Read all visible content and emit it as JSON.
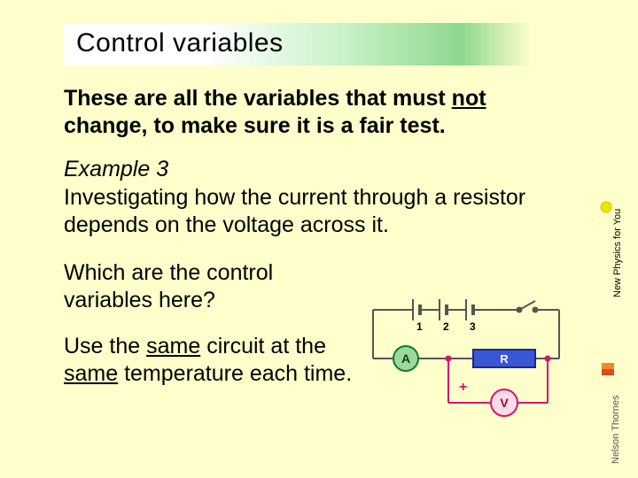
{
  "title": "Control variables",
  "intro": {
    "line1a": "These are all the variables that must ",
    "not": "not",
    "line2": "change, to make sure it is a fair test."
  },
  "example_label": "Example 3",
  "example_text": "Investigating how the current through a resistor depends on the voltage across it.",
  "question": "Which are the control variables here?",
  "answer": {
    "a": "Use the ",
    "same1": "same",
    "b": " circuit at the ",
    "same2": "same",
    "c": " temperature each time."
  },
  "circuit": {
    "cells": [
      "1",
      "2",
      "3"
    ],
    "ammeter": "A",
    "resistor": "R",
    "voltmeter": "V",
    "plus": "+"
  },
  "logos": {
    "top": "New Physics for You",
    "bottom": "Nelson Thornes"
  }
}
